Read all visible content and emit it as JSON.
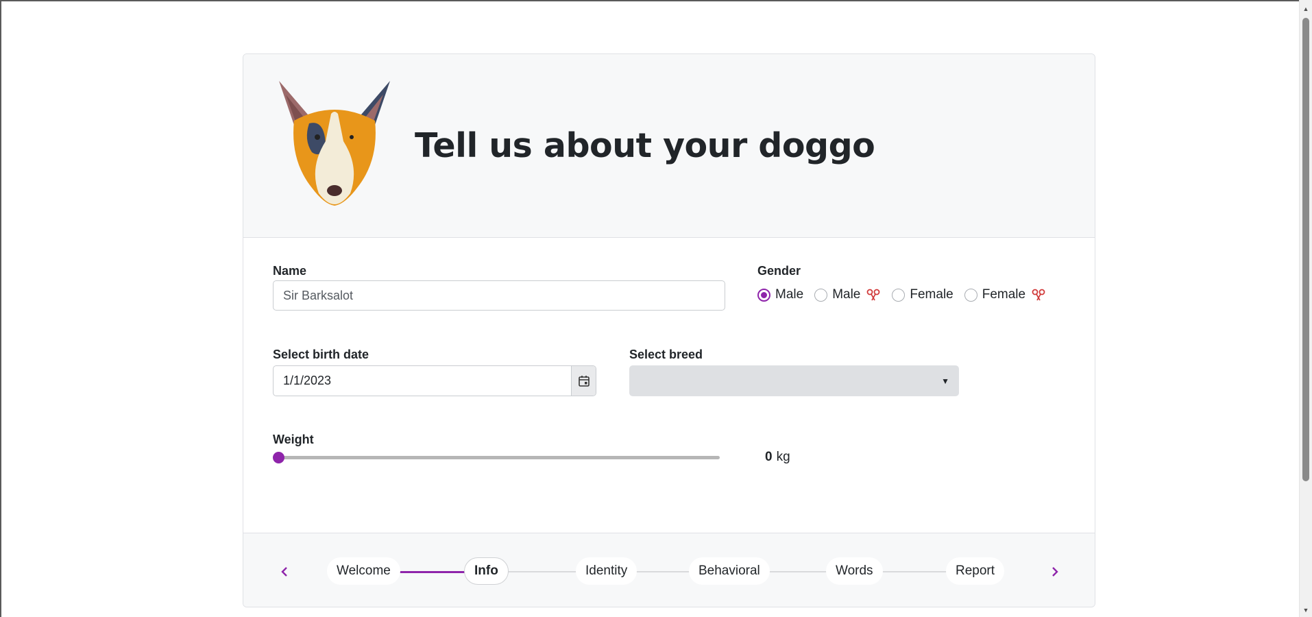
{
  "header": {
    "title": "Tell us about your doggo"
  },
  "form": {
    "name": {
      "label": "Name",
      "value": "Sir Barksalot"
    },
    "gender": {
      "label": "Gender",
      "options": [
        {
          "label": "Male",
          "checked": true,
          "neutered": false
        },
        {
          "label": "Male",
          "checked": false,
          "neutered": true
        },
        {
          "label": "Female",
          "checked": false,
          "neutered": false
        },
        {
          "label": "Female",
          "checked": false,
          "neutered": true
        }
      ]
    },
    "birth_date": {
      "label": "Select birth date",
      "value": "1/1/2023"
    },
    "breed": {
      "label": "Select breed",
      "value": ""
    },
    "weight": {
      "label": "Weight",
      "value": "0",
      "unit": "kg",
      "level": 0
    }
  },
  "stepper": {
    "steps": [
      {
        "label": "Welcome",
        "state": "done"
      },
      {
        "label": "Info",
        "state": "active"
      },
      {
        "label": "Identity",
        "state": "todo"
      },
      {
        "label": "Behavioral",
        "state": "todo"
      },
      {
        "label": "Words",
        "state": "todo"
      },
      {
        "label": "Report",
        "state": "todo"
      }
    ],
    "prev_icon": "chevron-left-icon",
    "next_icon": "chevron-right-icon"
  },
  "colors": {
    "accent": "#8e24aa",
    "header_bg": "#f7f8f9",
    "select_bg": "#dee0e3"
  }
}
